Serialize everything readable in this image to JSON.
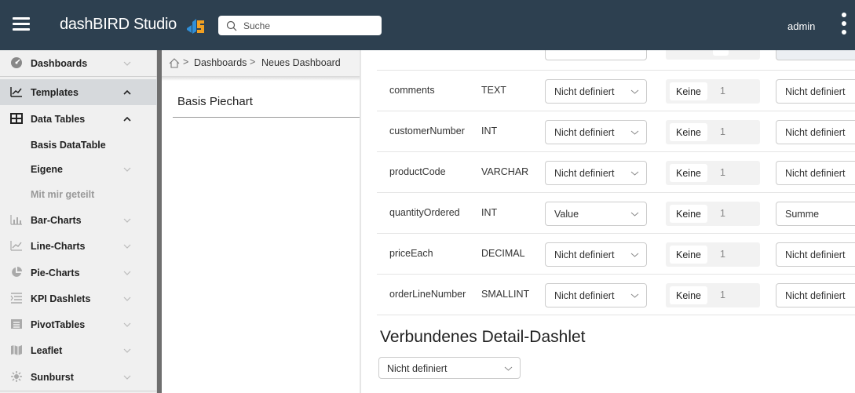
{
  "header": {
    "brand": "dashBIRD Studio",
    "search_placeholder": "Suche",
    "user": "admin",
    "bg_color": "#2d4050"
  },
  "sidebar": {
    "items": [
      {
        "label": "Dashboards",
        "icon": "dashboard-icon",
        "expanded": false
      },
      {
        "label": "Templates",
        "icon": "line-chart-icon",
        "expanded": true
      },
      {
        "label": "Data Tables",
        "icon": "table-icon",
        "expanded": true
      },
      {
        "label": "Basis DataTable"
      },
      {
        "label": "Eigene",
        "expanded": false
      },
      {
        "label": "Mit mir geteilt"
      },
      {
        "label": "Bar-Charts",
        "icon": "bar-chart-icon",
        "expanded": false
      },
      {
        "label": "Line-Charts",
        "icon": "line-chart-icon",
        "expanded": false
      },
      {
        "label": "Pie-Charts",
        "icon": "pie-chart-icon",
        "expanded": false
      },
      {
        "label": "KPI Dashlets",
        "icon": "kpi-icon",
        "expanded": false
      },
      {
        "label": "PivotTables",
        "icon": "pivot-icon",
        "expanded": false
      },
      {
        "label": "Leaflet",
        "icon": "map-icon",
        "expanded": false
      },
      {
        "label": "Sunburst",
        "icon": "sunburst-icon",
        "expanded": false
      }
    ]
  },
  "breadcrumb": {
    "items": [
      "Dashboards",
      "Neues Dashboard"
    ]
  },
  "panel": {
    "title": "Basis Piechart"
  },
  "fields": {
    "rows": [
      {
        "name": "comments",
        "type": "TEXT",
        "role": "Nicht definiert",
        "group": "Keine",
        "count": "1",
        "aggregation": "Nicht definiert"
      },
      {
        "name": "customerNumber",
        "type": "INT",
        "role": "Nicht definiert",
        "group": "Keine",
        "count": "1",
        "aggregation": "Nicht definiert"
      },
      {
        "name": "productCode",
        "type": "VARCHAR",
        "role": "Nicht definiert",
        "group": "Keine",
        "count": "1",
        "aggregation": "Nicht definiert"
      },
      {
        "name": "quantityOrdered",
        "type": "INT",
        "role": "Value",
        "group": "Keine",
        "count": "1",
        "aggregation": "Summe"
      },
      {
        "name": "priceEach",
        "type": "DECIMAL",
        "role": "Nicht definiert",
        "group": "Keine",
        "count": "1",
        "aggregation": "Nicht definiert"
      },
      {
        "name": "orderLineNumber",
        "type": "SMALLINT",
        "role": "Nicht definiert",
        "group": "Keine",
        "count": "1",
        "aggregation": "Nicht definiert"
      }
    ]
  },
  "detail": {
    "title": "Verbundenes Detail-Dashlet",
    "value": "Nicht definiert"
  }
}
